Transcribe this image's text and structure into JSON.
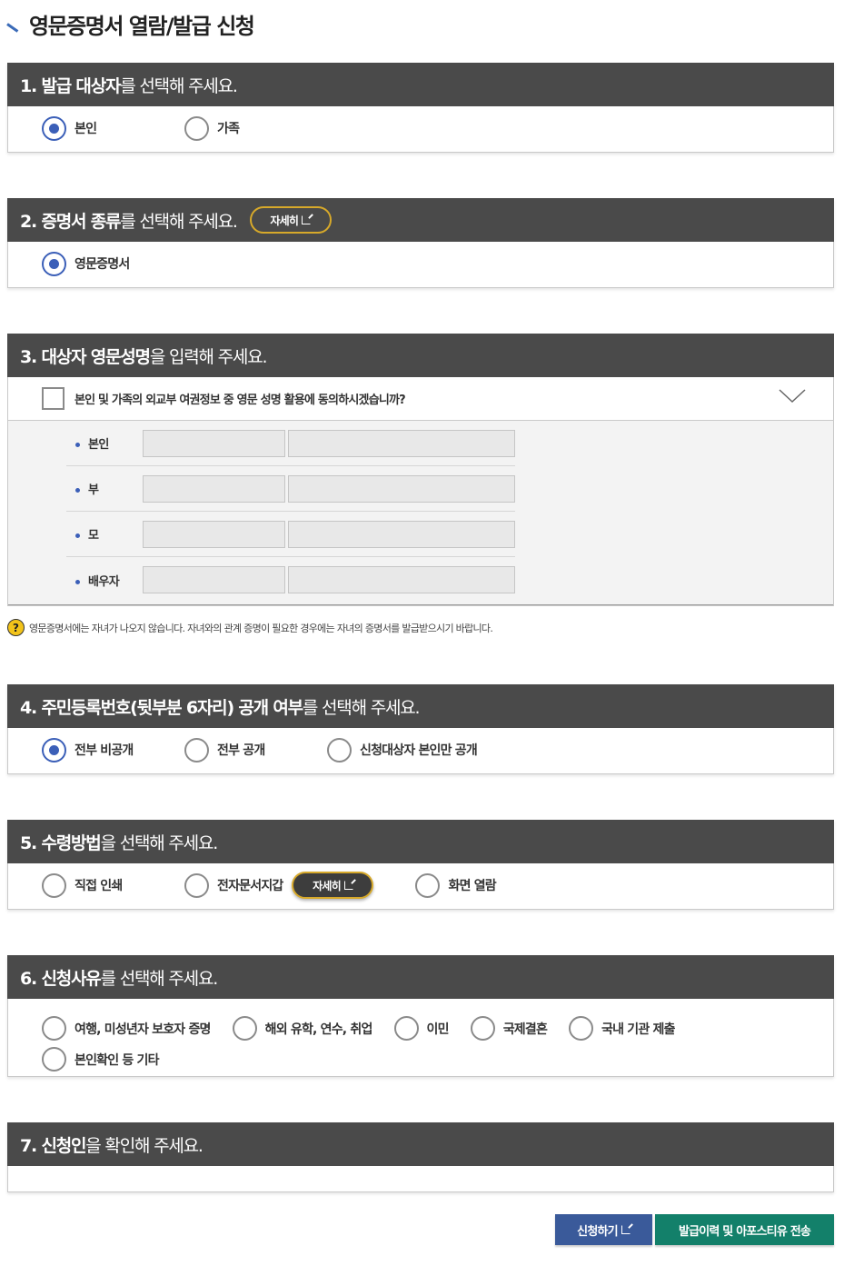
{
  "page_title": "영문증명서 열람/발급 신청",
  "sections": {
    "s1": {
      "head_bold": "1. 발급 대상자",
      "head_normal": "를 선택해 주세요.",
      "options": [
        "본인",
        "가족"
      ],
      "selected": "본인"
    },
    "s2": {
      "head_bold": "2. 증명서 종류",
      "head_normal": "를 선택해 주세요.",
      "detail": "자세히",
      "options": [
        "영문증명서"
      ],
      "selected": "영문증명서"
    },
    "s3": {
      "head_bold": "3. 대상자 영문성명",
      "head_normal": "을 입력해 주세요.",
      "consent": "본인 및 가족의 외교부 여권정보 중 영문 성명 활용에 동의하시겠습니까?",
      "rows": [
        "본인",
        "부",
        "모",
        "배우자"
      ],
      "notice": "영문증명서에는 자녀가 나오지 않습니다. 자녀와의 관계 증명이 필요한 경우에는 자녀의 증명서를 발급받으시기 바랍니다.",
      "notice_icon": "?"
    },
    "s4": {
      "head_bold": "4. 주민등록번호(뒷부분 6자리) 공개 여부",
      "head_normal": "를 선택해 주세요.",
      "options": [
        "전부 비공개",
        "전부 공개",
        "신청대상자 본인만 공개"
      ],
      "selected": "전부 비공개"
    },
    "s5": {
      "head_bold": "5. 수령방법",
      "head_normal": "을 선택해 주세요.",
      "options": [
        "직접 인쇄",
        "전자문서지갑",
        "화면 열람"
      ],
      "detail": "자세히"
    },
    "s6": {
      "head_bold": "6. 신청사유",
      "head_normal": "를 선택해 주세요.",
      "options": [
        "여행, 미성년자 보호자 증명",
        "해외 유학, 연수, 취업",
        "이민",
        "국제결혼",
        "국내 기관 제출",
        "본인확인 등 기타"
      ]
    },
    "s7": {
      "head_bold": "7. 신청인",
      "head_normal": "을 확인해 주세요."
    }
  },
  "buttons": {
    "apply": "신청하기",
    "send": "발급이력 및 아포스티유 전송"
  },
  "colors": {
    "header_bg": "#4a4a4a",
    "radio_selected": "#3b5fb8",
    "apply_btn": "#3a5a9a",
    "send_btn": "#13806a",
    "detail_border": "#d7a92a"
  }
}
